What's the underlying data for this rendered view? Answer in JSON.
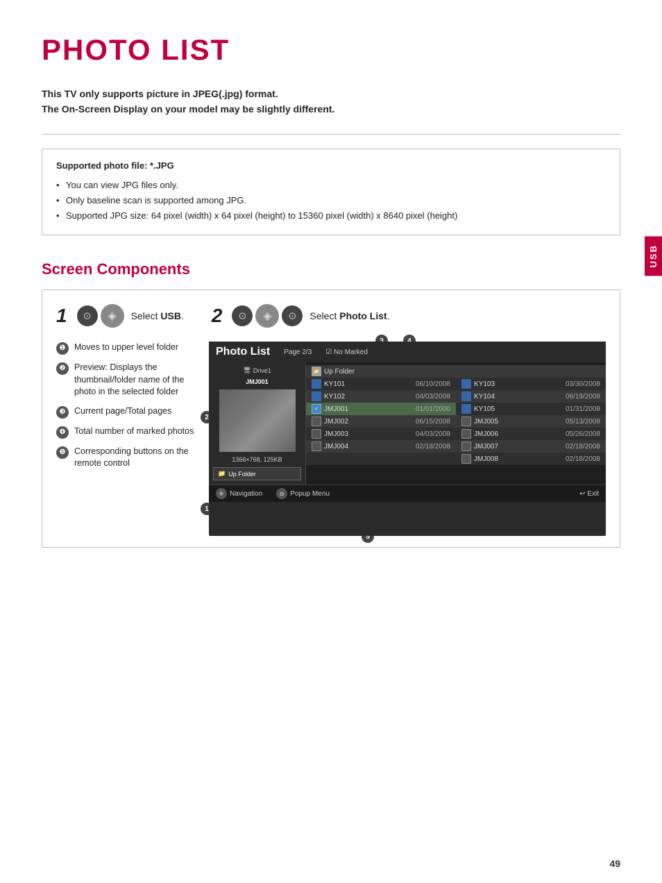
{
  "page": {
    "title": "PHOTO LIST",
    "subtitle1": "This TV only supports picture in JPEG(.jpg) format.",
    "subtitle2": "The On-Screen Display on your model may be slightly different.",
    "usb_tab": "USB"
  },
  "info_box": {
    "title": "Supported photo file: *.JPG",
    "bullets": [
      "You can view JPG files only.",
      "Only baseline scan is supported among JPG.",
      "Supported JPG size: 64 pixel (width) x 64 pixel (height) to 15360 pixel (width) x 8640 pixel (height)"
    ]
  },
  "screen_components": {
    "heading": "Screen Components",
    "step1": {
      "number": "1",
      "label": "Select USB."
    },
    "step2": {
      "number": "2",
      "label": "Select Photo List."
    },
    "annotations": [
      {
        "num": "❶",
        "text": "Moves to upper level folder"
      },
      {
        "num": "❷",
        "text": "Preview: Displays the thumbnail/folder name of the photo in the selected folder"
      },
      {
        "num": "❸",
        "text": "Current page/Total pages"
      },
      {
        "num": "❹",
        "text": "Total number of marked photos"
      },
      {
        "num": "❺",
        "text": "Corresponding buttons on the remote control"
      }
    ]
  },
  "photo_list_ui": {
    "title": "Photo List",
    "page": "Page 2/3",
    "marked": "No Marked",
    "drive": "Drive1",
    "filename": "JMJ001",
    "preview_info": "1366×768, 125KB",
    "upfolder_label": "Up Folder",
    "files_left": [
      {
        "name": "Up Folder",
        "date": "",
        "type": "folder",
        "col": 1
      },
      {
        "name": "KY101",
        "date": "06/10/2008",
        "type": "image"
      },
      {
        "name": "KY102",
        "date": "04/03/2008",
        "type": "image"
      },
      {
        "name": "JMJ001",
        "date": "01/01/2000",
        "type": "highlighted"
      },
      {
        "name": "JMJ002",
        "date": "06/15/2008",
        "type": "unchecked"
      },
      {
        "name": "JMJ003",
        "date": "04/03/2008",
        "type": "unchecked"
      },
      {
        "name": "JMJ004",
        "date": "02/18/2008",
        "type": "unchecked"
      }
    ],
    "files_right": [
      {
        "name": "KY103",
        "date": "03/30/2008",
        "type": "image"
      },
      {
        "name": "KY104",
        "date": "06/19/2008",
        "type": "image"
      },
      {
        "name": "KY105",
        "date": "01/31/2008",
        "type": "image"
      },
      {
        "name": "JMJ005",
        "date": "05/13/2008",
        "type": "unchecked"
      },
      {
        "name": "JMJ006",
        "date": "05/26/2008",
        "type": "unchecked"
      },
      {
        "name": "JMJ007",
        "date": "02/18/2008",
        "type": "unchecked"
      },
      {
        "name": "JMJ008",
        "date": "02/18/2008",
        "type": "unchecked"
      }
    ],
    "bottom_nav": "Navigation",
    "bottom_menu": "Popup Menu",
    "bottom_exit": "Exit"
  },
  "page_number": "49",
  "colors": {
    "accent": "#c0003c",
    "dark_bg": "#1e1e1e",
    "highlight": "#4a6a4a"
  }
}
